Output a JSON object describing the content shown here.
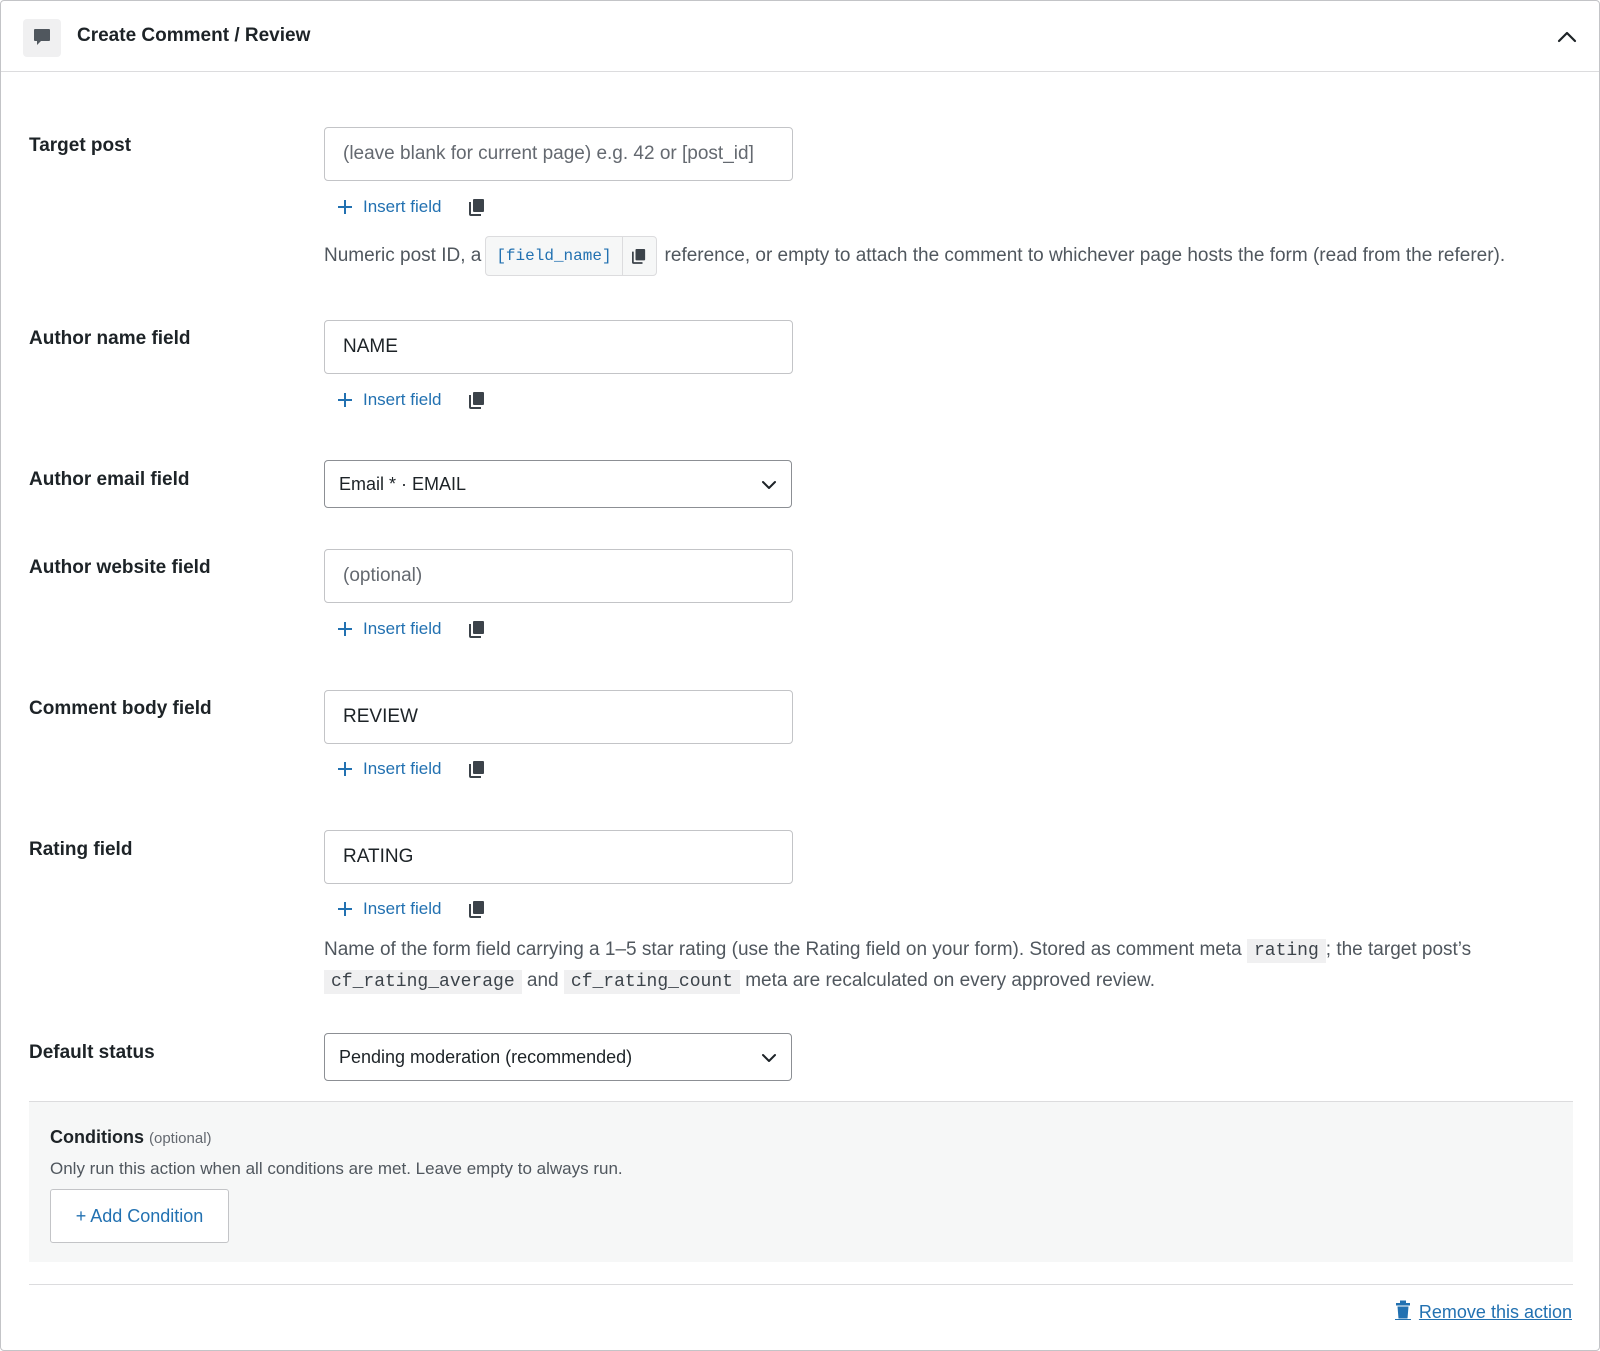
{
  "header": {
    "title": "Create Comment / Review"
  },
  "common": {
    "insert_field_label": "Insert field"
  },
  "fields": {
    "target_post": {
      "label": "Target post",
      "placeholder": "(leave blank for current page) e.g. 42 or [post_id]",
      "value": "",
      "help_before": "Numeric post ID, a",
      "help_code": "[field_name]",
      "help_after": "reference, or empty to attach the comment to whichever page hosts the form (read from the referer)."
    },
    "author_name": {
      "label": "Author name field",
      "value": "NAME"
    },
    "author_email": {
      "label": "Author email field",
      "selected": "Email * · EMAIL"
    },
    "author_website": {
      "label": "Author website field",
      "placeholder": "(optional)",
      "value": ""
    },
    "comment_body": {
      "label": "Comment body field",
      "value": "REVIEW"
    },
    "rating": {
      "label": "Rating field",
      "value": "RATING",
      "help_1": "Name of the form field carrying a 1–5 star rating (use the Rating field on your form). Stored as comment meta",
      "help_code_1": "rating",
      "help_2": "; the target post’s",
      "help_code_2": "cf_rating_average",
      "help_3": "and",
      "help_code_3": "cf_rating_count",
      "help_4": "meta are recalculated on every approved review."
    },
    "default_status": {
      "label": "Default status",
      "selected": "Pending moderation (recommended)"
    }
  },
  "conditions": {
    "title": "Conditions",
    "optional": "(optional)",
    "description": "Only run this action when all conditions are met. Leave empty to always run.",
    "add_label": "+ Add Condition"
  },
  "footer": {
    "remove_label": "Remove this action"
  },
  "colors": {
    "accent": "#2271b1",
    "label": "#1d2327",
    "muted": "#50575e",
    "border": "#c3c4c7",
    "panel_bg": "#f6f7f7"
  }
}
